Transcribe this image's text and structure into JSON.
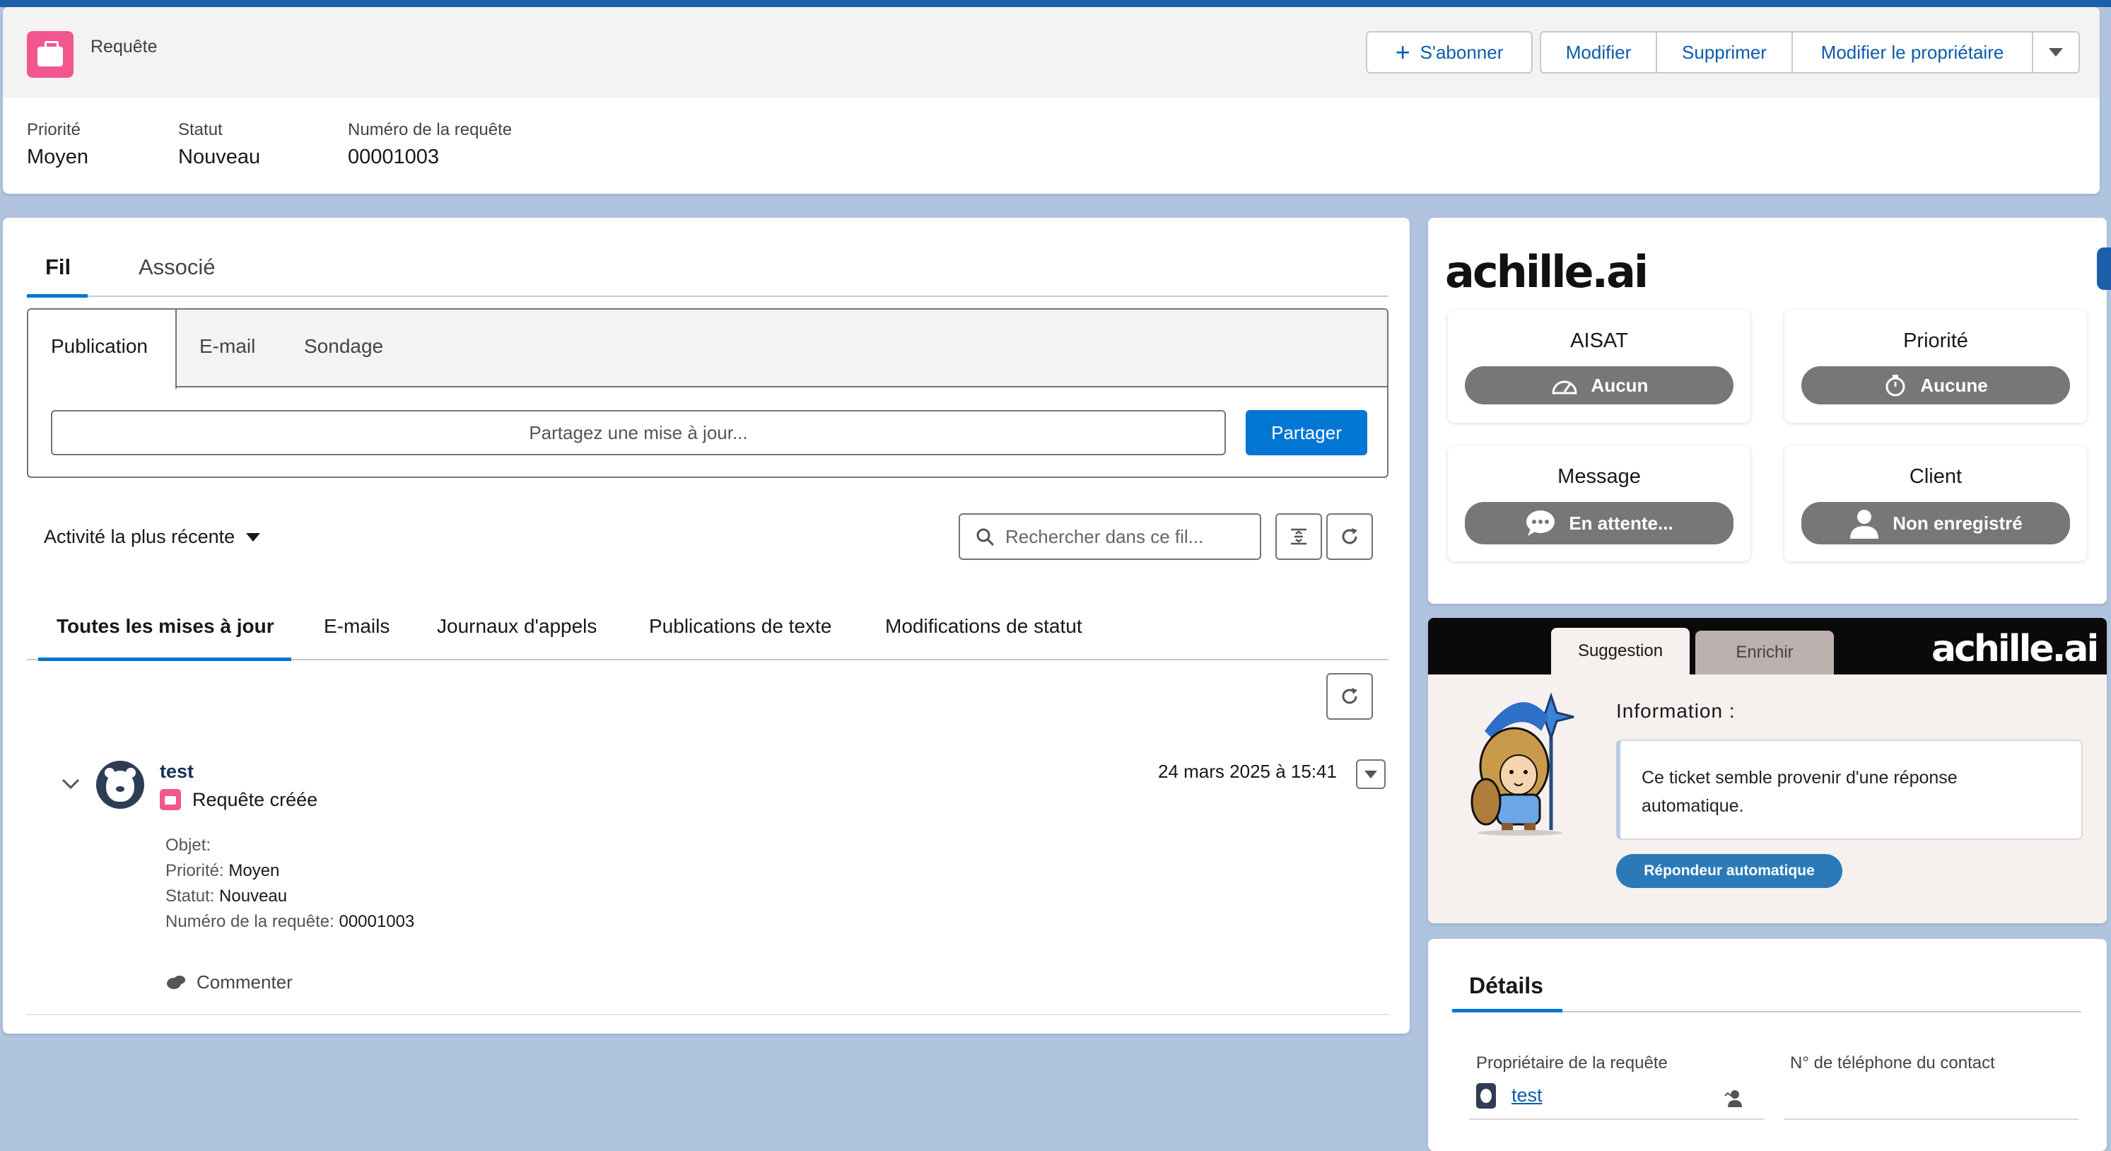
{
  "header": {
    "record_type": "Requête",
    "actions": {
      "subscribe": "S'abonner",
      "edit": "Modifier",
      "delete": "Supprimer",
      "change_owner": "Modifier le propriétaire"
    },
    "fields": [
      {
        "label": "Priorité",
        "value": "Moyen"
      },
      {
        "label": "Statut",
        "value": "Nouveau"
      },
      {
        "label": "Numéro de la requête",
        "value": "00001003"
      }
    ]
  },
  "feed": {
    "tabs": [
      "Fil",
      "Associé"
    ],
    "publisher": {
      "tabs": [
        "Publication",
        "E-mail",
        "Sondage"
      ],
      "placeholder": "Partagez une mise à jour...",
      "share_label": "Partager"
    },
    "sort_label": "Activité la plus récente",
    "search_placeholder": "Rechercher dans ce fil...",
    "filters": [
      "Toutes les mises à jour",
      "E-mails",
      "Journaux d'appels",
      "Publications de texte",
      "Modifications de statut"
    ],
    "item": {
      "author": "test",
      "action": "Requête créée",
      "timestamp": "24 mars 2025 à 15:41",
      "details": [
        {
          "label": "Objet:",
          "value": ""
        },
        {
          "label": "Priorité:",
          "value": " Moyen"
        },
        {
          "label": "Statut:",
          "value": " Nouveau"
        },
        {
          "label": "Numéro de la requête:",
          "value": " 00001003"
        }
      ],
      "comment_label": "Commenter"
    }
  },
  "achille": {
    "logo": "achille.ai",
    "tiles": [
      {
        "title": "AISAT",
        "value": "Aucun",
        "icon": "speedometer-icon"
      },
      {
        "title": "Priorité",
        "value": "Aucune",
        "icon": "stopwatch-icon"
      },
      {
        "title": "Message",
        "value": "En attente...",
        "icon": "chat-bubble-icon"
      },
      {
        "title": "Client",
        "value": "Non enregistré",
        "icon": "person-icon"
      }
    ],
    "pill_color": "#777777"
  },
  "suggestion": {
    "tabs": [
      "Suggestion",
      "Enrichir"
    ],
    "logo": "achille.ai",
    "info_title": "Information :",
    "info_text": "Ce ticket semble provenir d'une réponse automatique.",
    "tag": "Répondeur automatique"
  },
  "details": {
    "title": "Détails",
    "owner_label": "Propriétaire de la requête",
    "owner_value": "test",
    "phone_label": "N° de téléphone du contact"
  },
  "colors": {
    "brand": "#0176d3",
    "record_icon": "#f2568e",
    "background": "#b0c4df"
  }
}
